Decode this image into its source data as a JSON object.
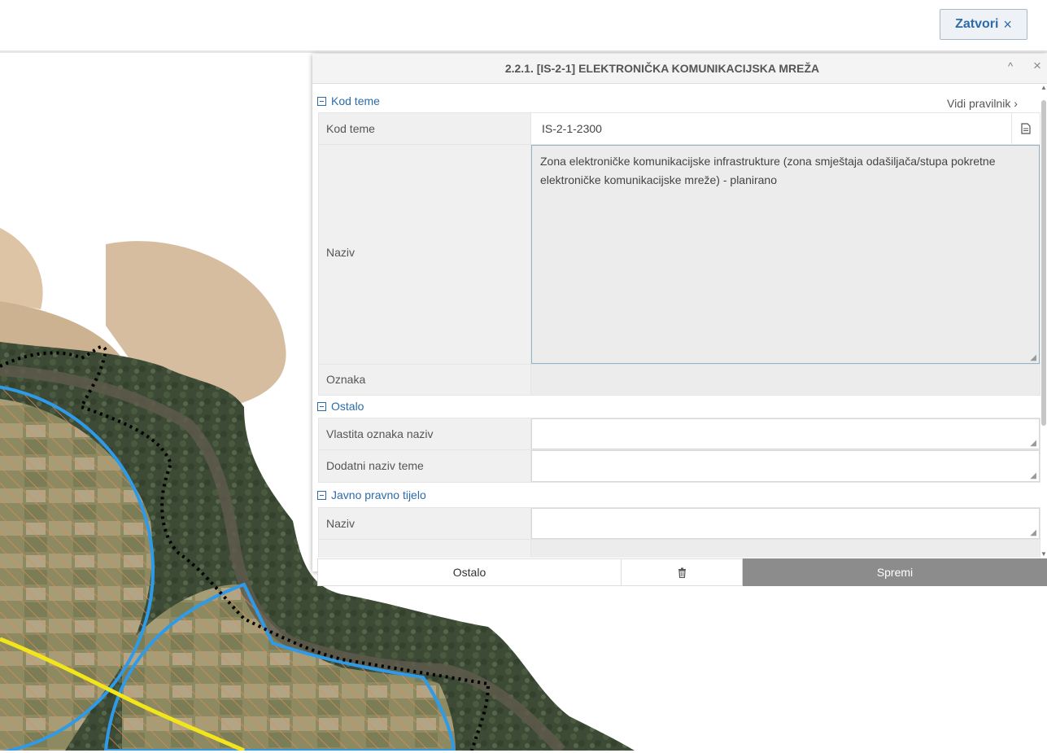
{
  "top": {
    "close_label": "Zatvori",
    "close_icon": "×"
  },
  "dialog": {
    "title": "2.2.1. [IS-2-1] ELEKTRONIČKA KOMUNIKACIJSKA MREŽA",
    "collapse_icon": "^",
    "close_icon": "×",
    "vidi_link": "Vidi pravilnik ›",
    "sections": {
      "kod_teme": {
        "title": "Kod teme",
        "fields": {
          "kod_label": "Kod teme",
          "kod_value": "IS-2-1-2300",
          "naziv_label": "Naziv",
          "naziv_value": "Zona elektroničke komunikacijske infrastrukture (zona smještaja odašiljača/stupa pokretne elektroničke komunikacijske mreže) - planirano",
          "oznaka_label": "Oznaka"
        }
      },
      "ostalo": {
        "title": "Ostalo",
        "fields": {
          "vlastita_label": "Vlastita oznaka naziv",
          "dodatni_label": "Dodatni naziv teme"
        }
      },
      "javno": {
        "title": "Javno pravno tijelo",
        "fields": {
          "naziv_label": "Naziv"
        }
      }
    },
    "footer": {
      "ostalo_label": "Ostalo",
      "delete_icon": "trash-icon",
      "spremi_label": "Spremi"
    }
  }
}
